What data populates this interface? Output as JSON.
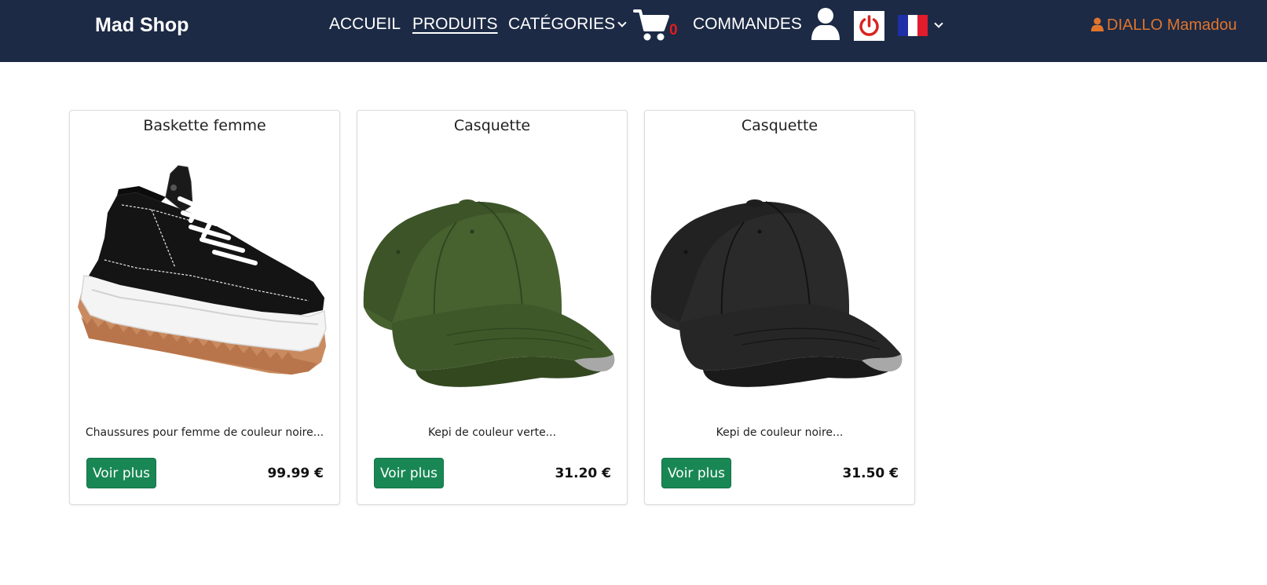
{
  "header": {
    "brand": "Mad Shop",
    "nav": {
      "accueil": "ACCUEIL",
      "produits": "PRODUITS",
      "categories": "CATÉGORIES",
      "commandes": "COMMANDES"
    },
    "cart_count": "0",
    "language": "fr",
    "user_name": "DIALLO Mamadou",
    "colors": {
      "navbar_bg": "#1c2a45",
      "user_name": "#e0742c",
      "cart_count": "#e11d1d",
      "power_icon": "#d9231f"
    }
  },
  "products": [
    {
      "title": "Baskette femme",
      "description": "Chaussures pour femme de couleur noire...",
      "button_label": "Voir plus",
      "price": "99.99 €",
      "image": "black-platform-sneaker"
    },
    {
      "title": "Casquette",
      "description": "Kepi de couleur verte...",
      "button_label": "Voir plus",
      "price": "31.20 €",
      "image": "green-baseball-cap"
    },
    {
      "title": "Casquette",
      "description": "Kepi de couleur noire...",
      "button_label": "Voir plus",
      "price": "31.50 €",
      "image": "black-baseball-cap"
    }
  ],
  "button_color": "#198754"
}
